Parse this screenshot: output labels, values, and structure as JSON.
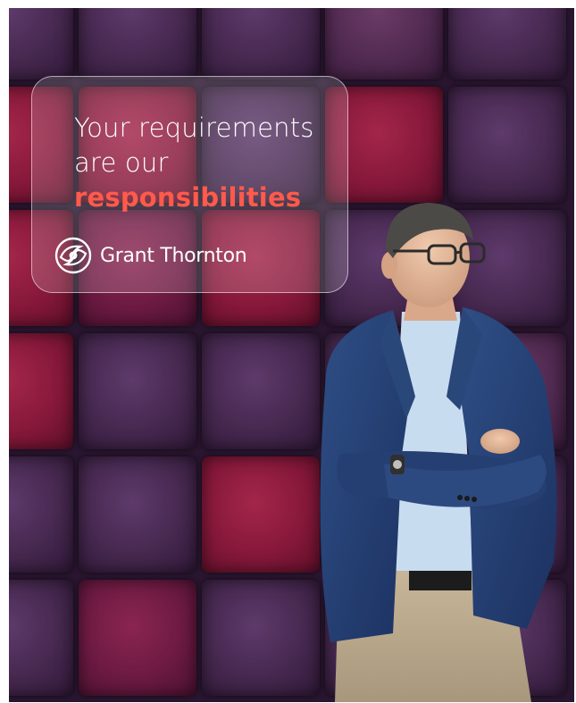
{
  "headline": {
    "line1": "Your requirements",
    "line2": "are our",
    "accent": "responsibilities"
  },
  "brand": {
    "name": "Grant Thornton",
    "logo_icon": "grant-thornton-swirl-icon"
  },
  "colors": {
    "accent": "#ff5a4a",
    "text": "#ffffff",
    "wall_purple": "#46284f",
    "wall_red": "#86183a"
  }
}
